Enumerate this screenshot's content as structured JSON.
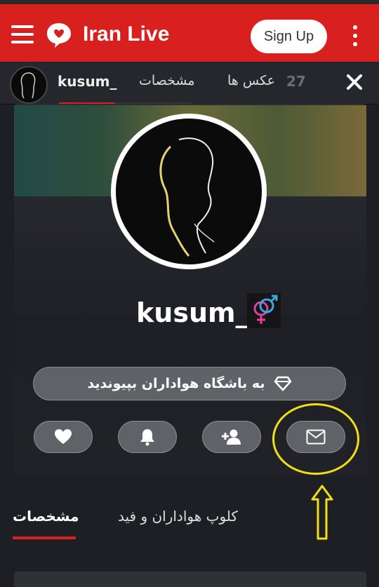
{
  "header": {
    "brand": "Iran Live",
    "signup_label": "Sign Up",
    "accent_color": "#d8201f"
  },
  "subheader": {
    "username": "kusum_",
    "tab_details": "مشخصات",
    "photos_count": "27",
    "tab_photos": "عکس ها"
  },
  "profile": {
    "display_name": "kusum_",
    "gender_icon": "gender-symbol-icon",
    "join_fanclub_label": "به باشگاه هواداران بپیوندید",
    "actions": [
      {
        "icon": "heart-icon"
      },
      {
        "icon": "bell-icon"
      },
      {
        "icon": "add-friend-icon"
      },
      {
        "icon": "mail-icon"
      }
    ],
    "annotation_color": "#f2e014"
  },
  "tabs": [
    {
      "label": "مشخصات",
      "active": true
    },
    {
      "label": "کلوپ هواداران و فید",
      "active": false
    }
  ]
}
